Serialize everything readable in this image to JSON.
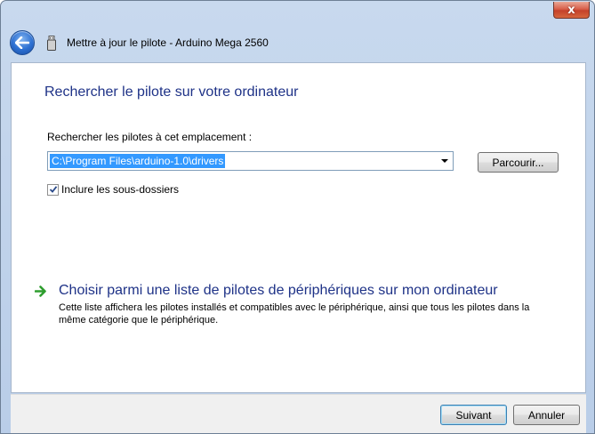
{
  "window": {
    "title": "Mettre à jour le pilote - Arduino Mega 2560",
    "close_glyph": "x"
  },
  "icons": {
    "back": "back-arrow-icon",
    "device": "usb-device-icon",
    "close": "close-icon",
    "choose": "green-arrow-icon"
  },
  "main": {
    "heading": "Rechercher le pilote sur votre ordinateur",
    "search_label": "Rechercher les pilotes à cet emplacement :",
    "path_value": "C:\\Program Files\\arduino-1.0\\drivers",
    "browse_label": "Parcourir...",
    "include_subfolders_label": "Inclure les sous-dossiers",
    "include_subfolders_checked": true,
    "choose_title": "Choisir parmi une liste de pilotes de périphériques sur mon ordinateur",
    "choose_description": "Cette liste affichera les pilotes installés et compatibles avec le périphérique, ainsi que tous les pilotes dans la même catégorie que le périphérique."
  },
  "footer": {
    "next_label": "Suivant",
    "cancel_label": "Annuler"
  },
  "colors": {
    "heading_blue": "#1e3287",
    "selection_blue": "#3399ff",
    "frame_blue": "#b9cde8",
    "arrow_green": "#2f9e2f"
  }
}
